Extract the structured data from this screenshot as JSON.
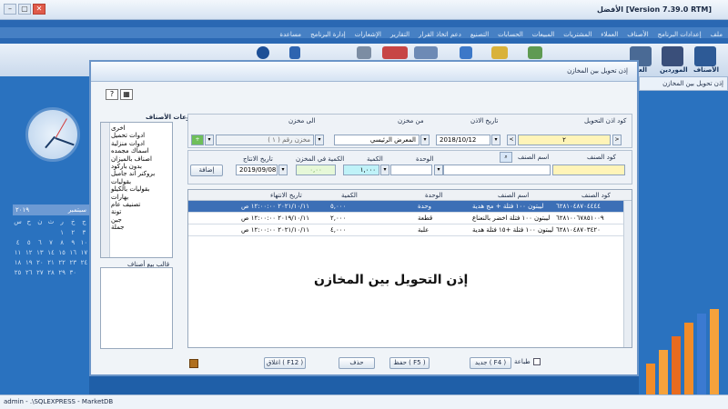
{
  "app": {
    "title": "[Version 7.39.0 RTM] الأفضل",
    "menu_items": [
      "ملف",
      "إعدادات البرنامج",
      "الأصناف",
      "العملاء",
      "المشتريات",
      "المبيعات",
      "الحسابات",
      "التصنيع",
      "دعم اتخاذ القرار",
      "التقارير",
      "الإشعارات",
      "إدارة البرنامج",
      "مساعدة"
    ],
    "toolbar": {
      "items_label": "الأصناف",
      "suppliers_label": "الموردين",
      "customers_label": "العملا"
    },
    "right_tab": "إذن تحويل بين المخازن",
    "status": "admin  -  .\\SQLEXPRESS  -  MarketDB"
  },
  "calendar": {
    "month": "سبتمبر",
    "year": "٢٠١٩",
    "weekdays": [
      "س",
      "ح",
      "ن",
      "ث",
      "ر",
      "خ",
      "ج"
    ],
    "days": [
      "",
      "",
      "",
      "",
      "١",
      "٢",
      "٣",
      "٤",
      "٥",
      "٦",
      "٧",
      "٨",
      "٩",
      "١٠",
      "١١",
      "١٢",
      "١٣",
      "١٤",
      "١٥",
      "١٦",
      "١٧",
      "١٨",
      "١٩",
      "٢٠",
      "٢١",
      "٢٢",
      "٢٣",
      "٢٤",
      "٢٥",
      "٢٦",
      "٢٧",
      "٢٨",
      "٢٩",
      "٣٠"
    ]
  },
  "dialog": {
    "title": "إذن تحويل بين المخازن",
    "categories_label": "مجموعات الأصناف",
    "categories": [
      "اخرى",
      "ادوات تحميل",
      "ادوات منزلية",
      "اسماك مجمده",
      "اصناف بالميزان",
      "بدون باركود",
      "بروكنر اند جامبل",
      "بقوليات",
      "بقوليات بالكيلو",
      "بهارات",
      "تصنيف عام",
      "تونة",
      "جبن",
      "جملة"
    ],
    "template_label": "قالب بيع أصناف",
    "header": {
      "doc_code_label": "كود اذن التحويل",
      "doc_code_value": "٢",
      "date_label": "تاريخ الاذن",
      "date_value": "2018/10/12",
      "from_label": "من مخزن",
      "from_value": "المعرض الرئيسي",
      "to_label": "الى مخزن",
      "to_value": "مخزن رقم ( ١ )"
    },
    "item_form": {
      "code_label": "كود الصنف",
      "name_label": "اسم الصنف",
      "unit_label": "الوحدة",
      "qty_label": "الكمية",
      "qty_value": "١,٠٠٠",
      "stock_label": "الكمية في المخزن",
      "stock_value": "٠,٠٠",
      "prod_date_label": "تاريخ الانتاج",
      "prod_date_value": "2019/09/08",
      "add_button": "إضافة"
    },
    "grid": {
      "columns": [
        "كود الصنف",
        "اسم الصنف",
        "الوحدة",
        "الكمية",
        "تاريخ الانتهاء"
      ],
      "rows": [
        [
          "٦٢٨١٠٤٨٧٠٤٤٤٤",
          "ليبتون ١٠٠ فتلة + مج هدية",
          "وحدة",
          "٥,٠٠٠",
          "٢٠٢١/١٠/١١ ١٢:٠٠:٠٠ ص"
        ],
        [
          "٦٢٨١٠٠٦٧٨٥١٠٠٩",
          "ليبتون ١٠٠ فتلة اخضر بالنعناع",
          "قطعة",
          "٢,٠٠٠",
          "٢٠١٩/١٠/١١ ١٢:٠٠:٠٠ ص"
        ],
        [
          "٦٢٨١٠٤٨٧٠٣٤٢٠",
          "ليبتون ١٠٠ فتلة +١٥ فتلة هدية",
          "علبة",
          "٤,٠٠٠",
          "٢٠٢١/١٠/١١ ١٢:٠٠:٠٠ ص"
        ]
      ]
    },
    "watermark": "إذن التحويل بين المخازن",
    "buttons": {
      "print": "طباعة",
      "new": "جديد ( F4 )",
      "save": "حفظ ( F5 )",
      "delete": "حذف",
      "close": "اغلاق ( F12 )"
    }
  }
}
